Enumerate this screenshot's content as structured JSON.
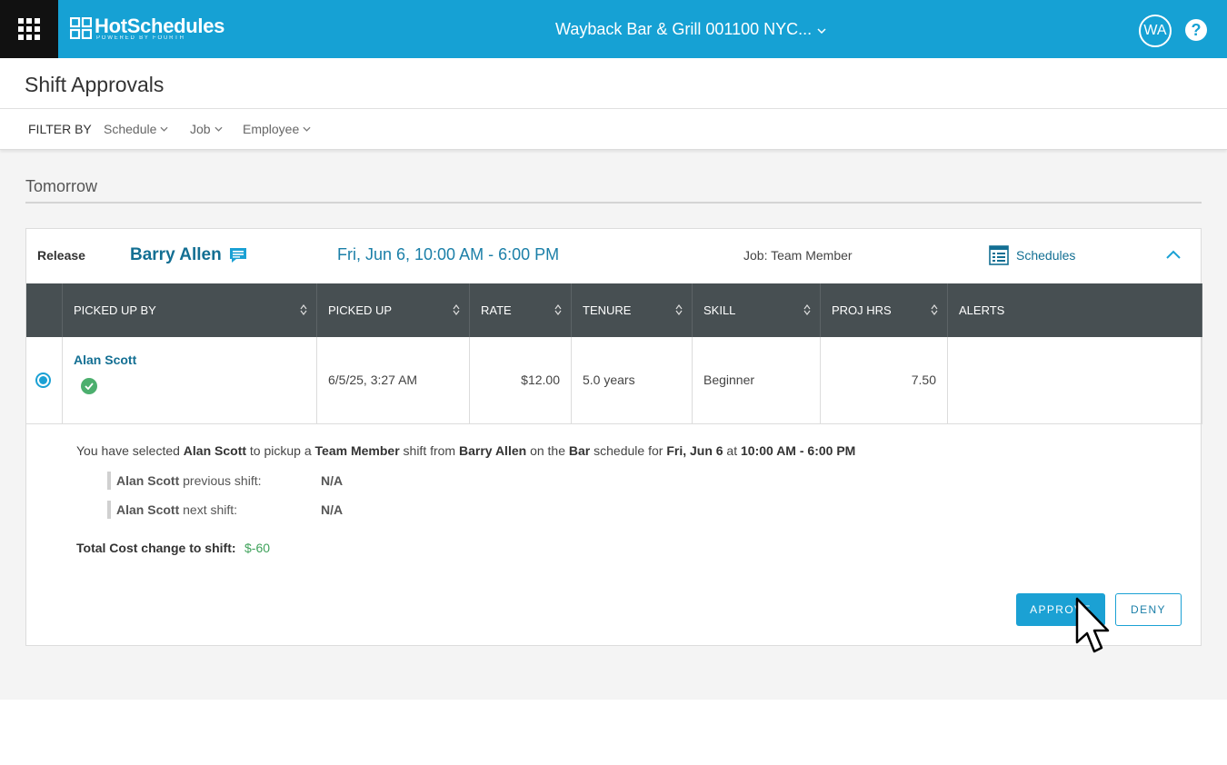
{
  "app": {
    "brand": "HotSchedules",
    "brand_tagline": "POWERED BY FOURTH",
    "location": "Wayback Bar & Grill 001100 NYC...",
    "user_initials": "WA",
    "help_label": "?"
  },
  "page": {
    "title": "Shift Approvals"
  },
  "filters": {
    "label": "FILTER BY",
    "items": [
      "Schedule",
      "Job",
      "Employee"
    ]
  },
  "section": {
    "title": "Tomorrow"
  },
  "request": {
    "type": "Release",
    "employee": "Barry Allen",
    "shift": "Fri, Jun 6, 10:00 AM - 6:00 PM",
    "job": "Job: Team Member",
    "schedules_link": "Schedules",
    "columns": [
      "PICKED UP BY",
      "PICKED UP",
      "RATE",
      "TENURE",
      "SKILL",
      "PROJ HRS",
      "ALERTS"
    ],
    "rows": [
      {
        "selected": true,
        "picked_up_by": "Alan Scott",
        "picked_up": "6/5/25, 3:27 AM",
        "rate": "$12.00",
        "tenure": "5.0 years",
        "skill": "Beginner",
        "proj_hrs": "7.50",
        "alerts": ""
      }
    ]
  },
  "summary": {
    "p1": "You have selected ",
    "picker": "Alan Scott",
    "p2": " to pickup a ",
    "job": "Team Member",
    "p3": " shift from ",
    "owner": "Barry Allen",
    "p4": " on the ",
    "schedule": "Bar",
    "p5": " schedule for ",
    "date": "Fri, Jun 6",
    "p6": " at ",
    "time": "10:00 AM - 6:00 PM",
    "previous_name": "Alan Scott",
    "previous_label": " previous shift:",
    "previous_value": "N/A",
    "next_name": "Alan Scott",
    "next_label": " next shift:",
    "next_value": "N/A",
    "total_label": "Total Cost change to shift:",
    "total_value": "$-60"
  },
  "actions": {
    "approve": "APPROVE",
    "deny": "DENY"
  },
  "colors": {
    "header": "#16a1d4",
    "dark": "#111111",
    "table_header": "#474f52",
    "link": "#136f93",
    "positive": "#3fa25b"
  }
}
